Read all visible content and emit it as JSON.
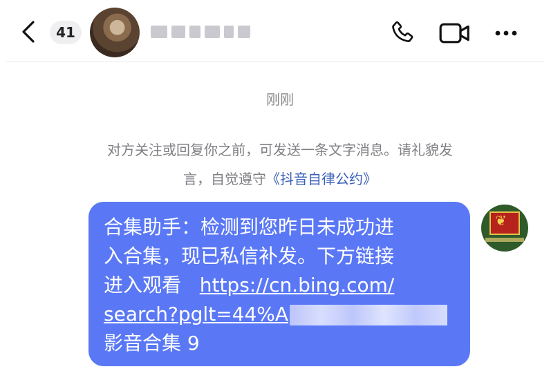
{
  "header": {
    "unread_count": "41",
    "icons": [
      "back-chevron-icon",
      "phone-icon",
      "video-call-icon",
      "more-icon"
    ]
  },
  "chat": {
    "timestamp": "刚刚",
    "notice_line1": "对方关注或回复你之前，可发送一条文字消息。请礼貌发",
    "notice_line2_prefix": "言，自觉遵守",
    "notice_link": "《抖音自律公约》",
    "message": {
      "line1": "合集助手：检测到您昨日未成功进",
      "line2": "入合集，现已私信补发。下方链接",
      "line3_text": "进入观看",
      "link_part1": "https://cn.bing.com/",
      "link_part2": "search?pglt=44%A",
      "line5": "影音合集 9"
    }
  },
  "colors": {
    "bubble": "#5a78f5",
    "link": "#3b5fb8",
    "muted_text": "#7f7f84"
  }
}
